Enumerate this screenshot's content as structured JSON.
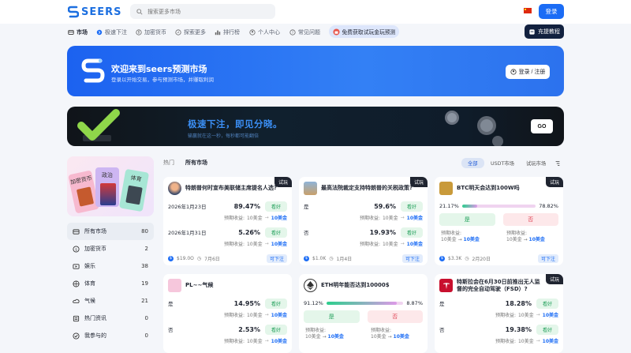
{
  "brand": {
    "name": "SEERS",
    "color": "#1c6fe0"
  },
  "header": {
    "search_placeholder": "搜索更多市场",
    "login_label": "登录"
  },
  "nav": {
    "items": [
      {
        "label": "市场",
        "icon": "market-icon",
        "active": true
      },
      {
        "label": "极速下注",
        "icon": "speed-icon"
      },
      {
        "label": "加密货币",
        "icon": "crypto-icon"
      },
      {
        "label": "探索更多",
        "icon": "compass-icon"
      },
      {
        "label": "排行榜",
        "icon": "ranking-icon"
      },
      {
        "label": "个人中心",
        "icon": "user-icon"
      },
      {
        "label": "常见问题",
        "icon": "help-icon"
      }
    ],
    "promo_label": "免费获取试玩金玩预测",
    "recharge_label": "充提教程"
  },
  "welcome": {
    "title": "欢迎来到seers预测市场",
    "subtitle": "登录以开始交易，参与预测市场，并赚取利润",
    "button_label": "登录 / 注册"
  },
  "speed_banner": {
    "title": "极速下注，即见分晓。",
    "subtitle": "输赢就在这一秒，每秒都可能翻倍",
    "button_label": "GO"
  },
  "categories": {
    "art_tags": [
      "加密货币",
      "政治",
      "体育"
    ],
    "items": [
      {
        "label": "所有市场",
        "count": "80",
        "icon": "all-markets-icon",
        "active": true
      },
      {
        "label": "加密货币",
        "count": "2",
        "icon": "crypto-icon"
      },
      {
        "label": "娱乐",
        "count": "38",
        "icon": "entertainment-icon"
      },
      {
        "label": "体育",
        "count": "19",
        "icon": "sports-icon"
      },
      {
        "label": "气候",
        "count": "21",
        "icon": "climate-icon"
      },
      {
        "label": "热门资讯",
        "count": "0",
        "icon": "news-icon"
      },
      {
        "label": "我参与的",
        "count": "0",
        "icon": "participated-icon"
      }
    ]
  },
  "tabs": [
    "热门",
    "所有市场"
  ],
  "filters": [
    "全部",
    "USDT市场",
    "试玩市场"
  ],
  "common": {
    "trial_badge": "试玩",
    "bet_label": "看好",
    "earn_label": "预期收益:",
    "stake": "10美金",
    "yes": "是",
    "no": "否",
    "arrow": "→"
  },
  "cards": [
    {
      "title": "特朗普何时宣布美联储主席提名人选?",
      "trial": true,
      "options": [
        {
          "label": "2026年1月23日",
          "pct": "89.47%",
          "win": "10美金"
        },
        {
          "label": "2026年1月31日",
          "pct": "5.26%",
          "win": "10美金"
        }
      ],
      "volume": "$19.0O",
      "date": "7月6日",
      "pill": "可下注"
    },
    {
      "title": "最高法院裁定支持特朗普的关税政策?",
      "trial": true,
      "options": [
        {
          "label": "是",
          "pct": "59.6%",
          "win": "10美金"
        },
        {
          "label": "否",
          "pct": "19.93%",
          "win": "10美金"
        }
      ],
      "volume": "$1.0K",
      "date": "1月4日",
      "pill": "可下注"
    },
    {
      "title": "BTC明天会达到100W吗",
      "trial": true,
      "yes_pct": "21.17%",
      "no_pct": "78.82%",
      "yes_fraction": 0.21,
      "earn_yes": "10美金",
      "earn_no": "10美金",
      "volume": "$3.3K",
      "date": "2月20日",
      "pill": "可下注"
    },
    {
      "title": "PL~~气候",
      "trial": false,
      "options": [
        {
          "label": "是",
          "pct": "14.95%",
          "win": "10美金"
        },
        {
          "label": "否",
          "pct": "2.53%",
          "win": "10美金"
        }
      ]
    },
    {
      "title": "ETH明年能否达到10000$",
      "trial": false,
      "yes_pct": "91.12%",
      "no_pct": "8.87%",
      "yes_fraction": 0.91,
      "earn_yes": "10美金",
      "earn_no": "10美金"
    },
    {
      "title": "特斯拉会在6月30日前推出无人监督的完全自动驾驶（FSD）?",
      "trial": true,
      "options": [
        {
          "label": "是",
          "pct": "18.28%",
          "win": "10美金"
        },
        {
          "label": "否",
          "pct": "19.38%",
          "win": "10美金"
        }
      ]
    }
  ]
}
